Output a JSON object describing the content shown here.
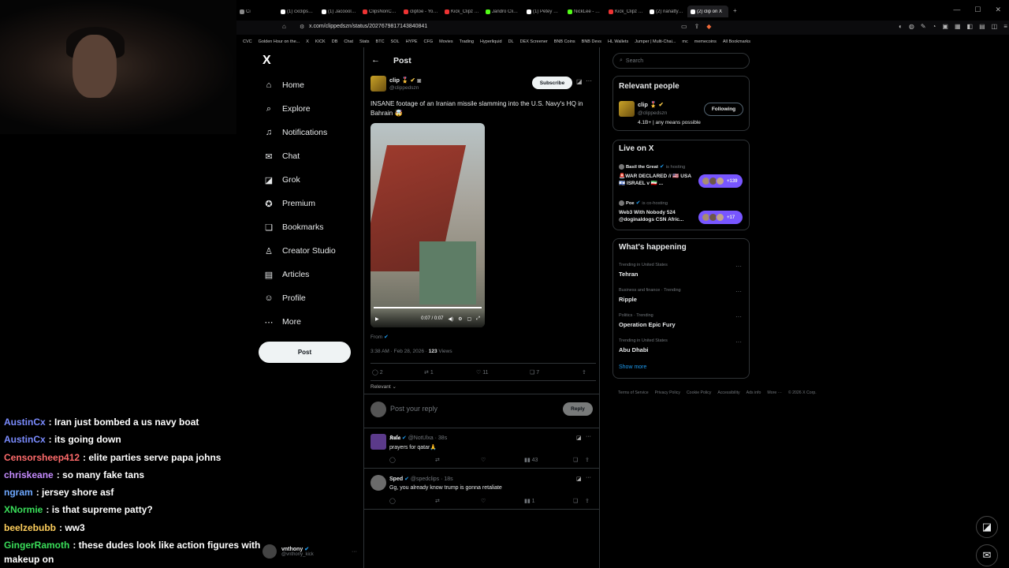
{
  "webcam": {},
  "chat": {
    "lines": [
      {
        "user": "AustinCx",
        "color": "#7b8cff",
        "text": ": Iran just bombed a us navy boat"
      },
      {
        "user": "AustinCx",
        "color": "#7b8cff",
        "text": ": its going down"
      },
      {
        "user": "Censorsheep412",
        "color": "#ff6b6b",
        "text": ": elite parties serve papa johns"
      },
      {
        "user": "chriskeane",
        "color": "#c58cff",
        "text": ": so many fake tans"
      },
      {
        "user": "ngram",
        "color": "#6ea8ff",
        "text": ": jersey shore asf"
      },
      {
        "user": "XNormie",
        "color": "#3adf5a",
        "text": ": is that supreme patty?"
      },
      {
        "user": "beelzebubb",
        "color": "#ffcf5c",
        "text": ": ww3"
      },
      {
        "user": "GingerRamoth",
        "color": "#3adf5a",
        "text": ": these dudes look like action figures with makeup on"
      }
    ]
  },
  "browser": {
    "tabs": [
      {
        "label": "Ci",
        "color": "#888"
      },
      {
        "label": "(1) cxclips_ on X/ \"Ir",
        "color": "#fff"
      },
      {
        "label": "(1) Jacoools Clips on",
        "color": "#fff"
      },
      {
        "label": "ClipsNonClaus - YouT",
        "color": "#e33"
      },
      {
        "label": "cliptoe - YouTube",
        "color": "#e33"
      },
      {
        "label": "Kick_Clipz - YouTube",
        "color": "#e33"
      },
      {
        "label": "Jandro Clips - Watch",
        "color": "#53fc18"
      },
      {
        "label": "(1) Petey Plastic (@P",
        "color": "#fff"
      },
      {
        "label": "NickLee - Watch the",
        "color": "#53fc18"
      },
      {
        "label": "Kick_Clipz - YouTube",
        "color": "#e33"
      },
      {
        "label": "(2) nanatty (@nanatt",
        "color": "#fff"
      },
      {
        "label": "(2) clip on X",
        "color": "#fff",
        "active": true
      }
    ],
    "url": "x.com/clippedszn/status/2027679817143840841",
    "bookmarks": [
      "CVC",
      "Golden Hour on the...",
      "X",
      "KICK",
      "DB",
      "Chat",
      "Stats",
      "BTC",
      "SOL",
      "HYPE",
      "CFG",
      "Movies",
      "Trading",
      "Hyperliquid",
      "DL",
      "DEX Screener",
      "BNB Coins",
      "BNB Devs",
      "HL Wallets",
      "Jumper | Multi-Chai...",
      "mc",
      "memecoins",
      "All Bookmarks"
    ]
  },
  "nav": {
    "logo": "X",
    "items": [
      {
        "label": "Home",
        "icon": "⌂"
      },
      {
        "label": "Explore",
        "icon": "⌕"
      },
      {
        "label": "Notifications",
        "icon": "♫"
      },
      {
        "label": "Chat",
        "icon": "✉"
      },
      {
        "label": "Grok",
        "icon": "◪"
      },
      {
        "label": "Premium",
        "icon": "✪"
      },
      {
        "label": "Bookmarks",
        "icon": "❏"
      },
      {
        "label": "Creator Studio",
        "icon": "♙"
      },
      {
        "label": "Articles",
        "icon": "▤"
      },
      {
        "label": "Profile",
        "icon": "☺"
      },
      {
        "label": "More",
        "icon": "⋯"
      }
    ],
    "post_button": "Post",
    "account": {
      "name": "vnthony",
      "handle": "@vnthony_kick"
    }
  },
  "post": {
    "header_title": "Post",
    "author": {
      "name": "clip 🎖️",
      "handle": "@clippedszn"
    },
    "subscribe_label": "Subscribe",
    "text": "INSANE footage of an Iranian missile slamming into the U.S. Navy's HQ in Bahrain 🤯",
    "video": {
      "time": "0:07 / 0:07"
    },
    "from_label": "From",
    "timestamp": "3:38 AM · Feb 28, 2026 ·",
    "views_count": "123",
    "views_label": "Views",
    "stats": {
      "replies": "2",
      "reposts": "1",
      "likes": "11",
      "bookmarks": "7"
    },
    "sort_label": "Relevant ⌄",
    "reply_placeholder": "Post your reply",
    "reply_button": "Reply"
  },
  "replies": [
    {
      "name": "𝕶𝖚𝖑𝖆",
      "handle": "@NotUlxa · 38s",
      "text": "prayers for qatar🙏",
      "views": "43"
    },
    {
      "name": "Sped",
      "handle": "@spedclips · 18s",
      "text": "Gg, you already know trump is gonna retaliate",
      "views": "1"
    }
  ],
  "sidebar": {
    "search_placeholder": "Search",
    "relevant_title": "Relevant people",
    "relevant": {
      "name": "clip 🎖️",
      "handle": "@clippedszn",
      "bio": "4.1B+ | any means possible",
      "follow_label": "Following"
    },
    "live_title": "Live on X",
    "live": [
      {
        "host": "Basil the Great",
        "status": "is hosting",
        "title": "🚨WAR DECLARED // 🇺🇸 USA 🇮🇱 ISRAEL v 🇮🇷 ...",
        "count": "+139"
      },
      {
        "host": "Poe",
        "status": "is co-hosting",
        "title": "Web3 With Nobody 524 @doginaldogs CSN Afric...",
        "count": "+17"
      }
    ],
    "happening_title": "What's happening",
    "trends": [
      {
        "meta": "Trending in United States",
        "name": "Tehran"
      },
      {
        "meta": "Business and finance · Trending",
        "name": "Ripple"
      },
      {
        "meta": "Politics · Trending",
        "name": "Operation Epic Fury"
      },
      {
        "meta": "Trending in United States",
        "name": "Abu Dhabi"
      }
    ],
    "show_more": "Show more",
    "footer": [
      "Terms of Service",
      "Privacy Policy",
      "Cookie Policy",
      "Accessibility",
      "Ads info",
      "More ···",
      "© 2026 X Corp."
    ]
  }
}
